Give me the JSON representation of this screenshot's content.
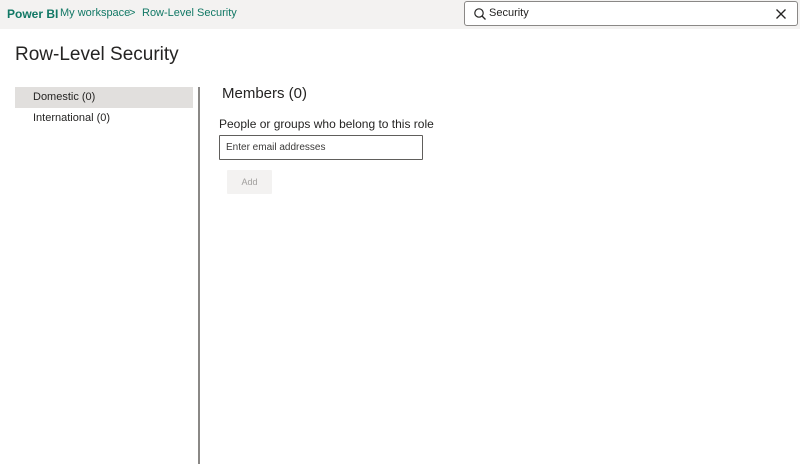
{
  "header": {
    "brand": "Power BI",
    "breadcrumb": {
      "workspace": "My workspace",
      "separator": ">",
      "current": "Row-Level Security"
    },
    "search": {
      "value": "Security",
      "icon": "search-icon",
      "clear_icon": "close-icon"
    }
  },
  "page": {
    "title": "Row-Level Security"
  },
  "roles": [
    {
      "label": "Domestic (0)",
      "selected": true
    },
    {
      "label": "International (0)",
      "selected": false
    }
  ],
  "members": {
    "title": "Members (0)",
    "field_label": "People or groups who belong to this role",
    "input_placeholder": "Enter email addresses",
    "input_value": "",
    "add_label": "Add"
  },
  "colors": {
    "accent": "#117865",
    "topbar_bg": "#f3f2f1",
    "selected_bg": "#e1dfdd"
  }
}
